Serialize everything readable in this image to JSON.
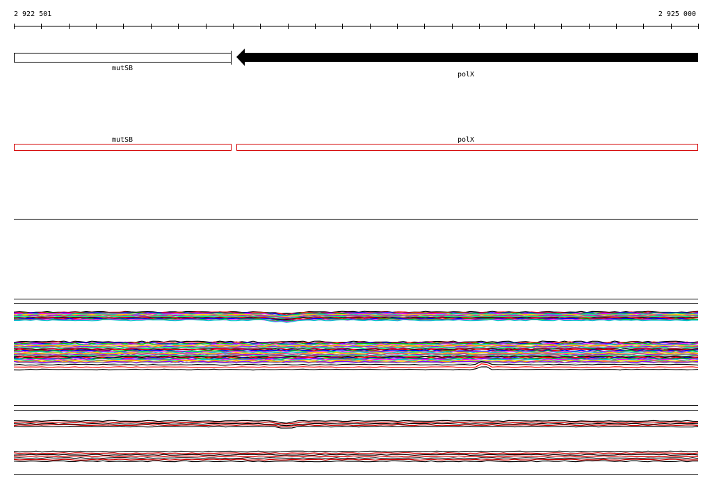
{
  "ruler": {
    "start_label": "2 922 501",
    "end_label": "2 925 000",
    "start": 2922501,
    "end": 2925000
  },
  "genes": [
    {
      "name": "mutSB",
      "strand": "none",
      "start": 2922501,
      "end": 2923295
    },
    {
      "name": "polX",
      "strand": "-",
      "start": 2923316,
      "end": 2925000
    }
  ],
  "features": [
    {
      "name": "mutSB",
      "start": 2922501,
      "end": 2923295,
      "color": "#d40000"
    },
    {
      "name": "polX",
      "start": 2923316,
      "end": 2925000,
      "color": "#d40000"
    }
  ],
  "coverage_track_1": {
    "series_count": 40,
    "palette": [
      "#000000",
      "#ff0000",
      "#0000ff",
      "#00cc00",
      "#ff00ff",
      "#00cccc",
      "#ffcc00",
      "#ff8800",
      "#8800ff",
      "#888888",
      "#00ff88",
      "#cc0044"
    ]
  },
  "coverage_track_2": {
    "series_count": 10,
    "palette": [
      "#000000",
      "#d40000"
    ]
  }
}
